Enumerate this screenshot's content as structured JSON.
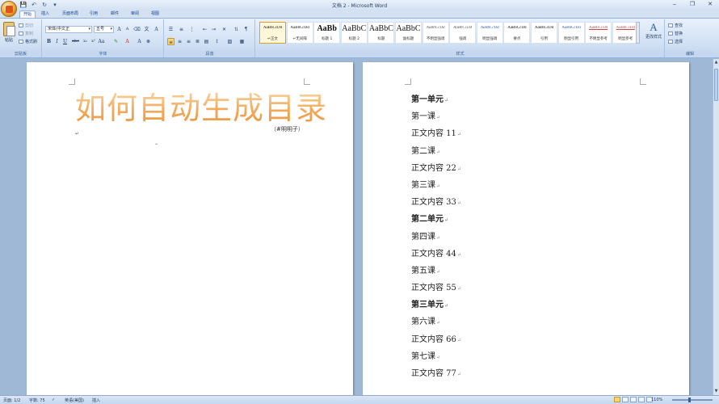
{
  "window": {
    "title": "文档 2 - Microsoft Word",
    "controls": [
      "‒",
      "❐",
      "✕"
    ]
  },
  "tabs": [
    {
      "label": "开始",
      "active": true
    },
    {
      "label": "插入"
    },
    {
      "label": "页面布局"
    },
    {
      "label": "引用"
    },
    {
      "label": "邮件"
    },
    {
      "label": "审阅"
    },
    {
      "label": "视图"
    }
  ],
  "ribbon": {
    "clipboard": {
      "label": "剪贴板",
      "paste": "粘贴",
      "cut": "剪切",
      "copy": "复制",
      "format_painter": "格式刷"
    },
    "font": {
      "label": "字体",
      "font_name": "宋体(中文正",
      "font_size": "五号"
    },
    "paragraph": {
      "label": "段落"
    },
    "styles": {
      "label": "样式",
      "items": [
        {
          "sample": "AaBbCcDd",
          "name": "↵正文",
          "selected": true
        },
        {
          "sample": "AaBbCcDd",
          "name": "↵无间隔"
        },
        {
          "sample": "AaBb",
          "name": "标题 1"
        },
        {
          "sample": "AaBbC",
          "name": "标题 2"
        },
        {
          "sample": "AaBbC",
          "name": "标题"
        },
        {
          "sample": "AaBbC",
          "name": "副标题"
        },
        {
          "sample": "AaBbCcDd",
          "name": "不明显强调"
        },
        {
          "sample": "AaBbCcDd",
          "name": "强调"
        },
        {
          "sample": "AaBbCcDd",
          "name": "明显强调"
        },
        {
          "sample": "AaBbCcDd",
          "name": "要点"
        },
        {
          "sample": "AaBbCcDd",
          "name": "引用"
        },
        {
          "sample": "AaBbCcDd",
          "name": "明显引用"
        },
        {
          "sample": "AaBbCcDd",
          "name": "不明显参考"
        },
        {
          "sample": "AaBbCcDd",
          "name": "明显参考"
        }
      ],
      "change_styles": "更改样式"
    },
    "editing": {
      "label": "编辑",
      "find": "查找",
      "replace": "替换",
      "select": "选择"
    }
  },
  "document": {
    "page1": {
      "title": "如何自动生成目录",
      "byline": "（#明明子）"
    },
    "page2": {
      "lines": [
        {
          "text": "第一单元",
          "bold": true
        },
        {
          "text": "第一课"
        },
        {
          "text": "正文内容 11"
        },
        {
          "text": "第二课"
        },
        {
          "text": "正文内容 22"
        },
        {
          "text": "第三课"
        },
        {
          "text": "正文内容 33"
        },
        {
          "text": "第二单元",
          "bold": true
        },
        {
          "text": "第四课"
        },
        {
          "text": "正文内容 44"
        },
        {
          "text": "第五课"
        },
        {
          "text": "正文内容 55"
        },
        {
          "text": "第三单元",
          "bold": true
        },
        {
          "text": "第六课"
        },
        {
          "text": "正文内容 66"
        },
        {
          "text": "第七课"
        },
        {
          "text": "正文内容 77"
        }
      ]
    }
  },
  "status": {
    "page": "页面: 1/2",
    "words": "字数: 75",
    "language": "英语(美国)",
    "mode": "插入",
    "zoom": "110%"
  }
}
